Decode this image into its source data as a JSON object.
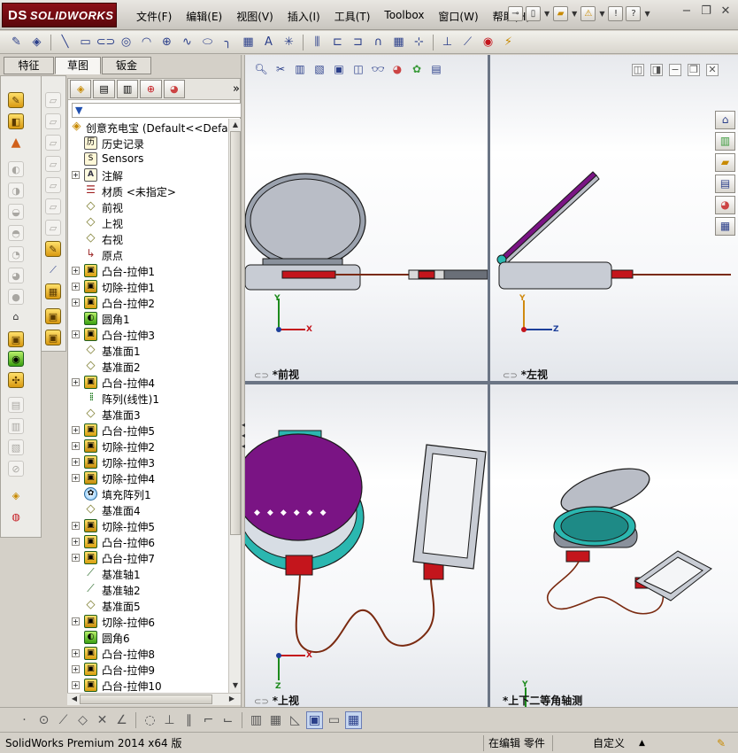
{
  "app": {
    "logo_mark": "DS",
    "logo_text": "SOLIDWORKS"
  },
  "menu": [
    {
      "label": "文件(F)"
    },
    {
      "label": "编辑(E)"
    },
    {
      "label": "视图(V)"
    },
    {
      "label": "插入(I)"
    },
    {
      "label": "工具(T)"
    },
    {
      "label": "Toolbox"
    },
    {
      "label": "窗口(W)"
    },
    {
      "label": "帮助(H)"
    }
  ],
  "command_tabs": [
    {
      "label": "特征"
    },
    {
      "label": "草图"
    },
    {
      "label": "钣金"
    }
  ],
  "tree": {
    "root": "创意充电宝  (Default<<Default",
    "items": [
      {
        "label": "历史记录"
      },
      {
        "label": "Sensors"
      },
      {
        "label": "注解"
      },
      {
        "label": "材质 <未指定>"
      },
      {
        "label": "前视"
      },
      {
        "label": "上视"
      },
      {
        "label": "右视"
      },
      {
        "label": "原点"
      },
      {
        "label": "凸台-拉伸1"
      },
      {
        "label": "切除-拉伸1"
      },
      {
        "label": "凸台-拉伸2"
      },
      {
        "label": "圆角1"
      },
      {
        "label": "凸台-拉伸3"
      },
      {
        "label": "基准面1"
      },
      {
        "label": "基准面2"
      },
      {
        "label": "凸台-拉伸4"
      },
      {
        "label": "阵列(线性)1"
      },
      {
        "label": "基准面3"
      },
      {
        "label": "凸台-拉伸5"
      },
      {
        "label": "切除-拉伸2"
      },
      {
        "label": "切除-拉伸3"
      },
      {
        "label": "切除-拉伸4"
      },
      {
        "label": "填充阵列1"
      },
      {
        "label": "基准面4"
      },
      {
        "label": "切除-拉伸5"
      },
      {
        "label": "凸台-拉伸6"
      },
      {
        "label": "凸台-拉伸7"
      },
      {
        "label": "基准轴1"
      },
      {
        "label": "基准轴2"
      },
      {
        "label": "基准面5"
      },
      {
        "label": "切除-拉伸6"
      },
      {
        "label": "圆角6"
      },
      {
        "label": "凸台-拉伸8"
      },
      {
        "label": "凸台-拉伸9"
      },
      {
        "label": "凸台-拉伸10"
      }
    ]
  },
  "views": {
    "front": {
      "label": "*前视"
    },
    "left": {
      "label": "*左视"
    },
    "top": {
      "label": "*上视"
    },
    "iso": {
      "label": "*上下二等角轴测"
    }
  },
  "axis": {
    "x": "X",
    "y": "Y",
    "z": "Z"
  },
  "status": {
    "product": "SolidWorks Premium 2014 x64 版",
    "mode": "在编辑 零件",
    "units": "自定义"
  },
  "colors": {
    "logo_red": "#7a0c12",
    "lid_purple": "#7a1484",
    "base_teal": "#2bb7b0",
    "plug_red": "#c4151c",
    "body_gray": "#b9bdc6"
  }
}
